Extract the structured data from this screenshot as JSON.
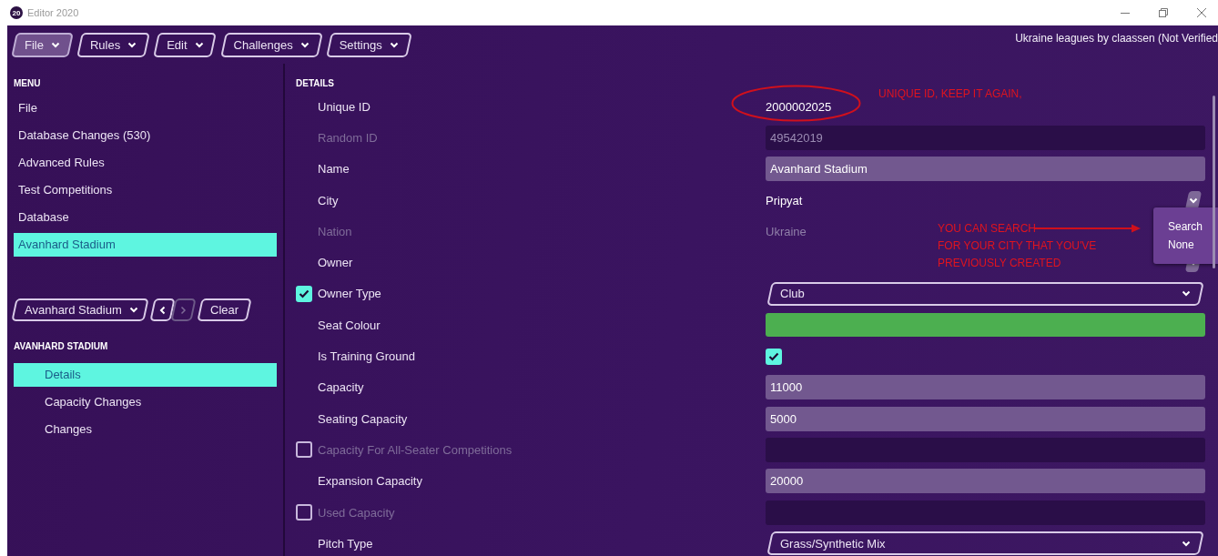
{
  "window": {
    "title": "Editor 2020",
    "logo": "20"
  },
  "menu_bar": [
    {
      "label": "File",
      "selected": true
    },
    {
      "label": "Rules",
      "selected": false
    },
    {
      "label": "Edit",
      "selected": false
    },
    {
      "label": "Challenges",
      "selected": false
    },
    {
      "label": "Settings",
      "selected": false
    }
  ],
  "project_label": "Ukraine leagues by claassen (Not Verified",
  "sidebar": {
    "heading": "MENU",
    "items": [
      {
        "label": "File",
        "selected": false
      },
      {
        "label": "Database Changes (530)",
        "selected": false
      },
      {
        "label": "Advanced Rules",
        "selected": false
      },
      {
        "label": "Test Competitions",
        "selected": false
      },
      {
        "label": "Database",
        "selected": false
      },
      {
        "label": "Avanhard Stadium",
        "selected": true
      }
    ],
    "picker": {
      "value": "Avanhard Stadium",
      "prev_disabled": false,
      "next_disabled": true,
      "clear_label": "Clear"
    },
    "section_heading": "AVANHARD STADIUM",
    "sub_items": [
      {
        "label": "Details",
        "selected": true
      },
      {
        "label": "Capacity Changes",
        "selected": false
      },
      {
        "label": "Changes",
        "selected": false
      }
    ]
  },
  "details": {
    "heading": "DETAILS",
    "rows": [
      {
        "label": "Unique ID",
        "kind": "text",
        "value": "2000002025",
        "disabled": false
      },
      {
        "label": "Random ID",
        "kind": "field",
        "value": "49542019",
        "disabled": true
      },
      {
        "label": "Name",
        "kind": "field",
        "value": "Avanhard Stadium",
        "disabled": false
      },
      {
        "label": "City",
        "kind": "picker",
        "value": "Pripyat",
        "disabled": false
      },
      {
        "label": "Nation",
        "kind": "text",
        "value": "Ukraine",
        "disabled": true
      },
      {
        "label": "Owner",
        "kind": "picker",
        "disabled": false
      },
      {
        "label": "Owner Type",
        "kind": "select",
        "value": "Club",
        "disabled": false,
        "checkbox": {
          "checked": true
        }
      },
      {
        "label": "Seat Colour",
        "kind": "swatch",
        "color": "#4caf50",
        "disabled": false
      },
      {
        "label": "Is Training Ground",
        "kind": "checkbox",
        "checked": true,
        "disabled": false
      },
      {
        "label": "Capacity",
        "kind": "field",
        "value": "11000",
        "disabled": false
      },
      {
        "label": "Seating Capacity",
        "kind": "field",
        "value": "5000",
        "disabled": false
      },
      {
        "label": "Capacity For All-Seater Competitions",
        "kind": "field",
        "disabled": true,
        "checkbox": {
          "checked": false
        }
      },
      {
        "label": "Expansion Capacity",
        "kind": "field",
        "value": "20000",
        "disabled": false
      },
      {
        "label": "Used Capacity",
        "kind": "field",
        "disabled": true,
        "checkbox": {
          "checked": false
        }
      },
      {
        "label": "Pitch Type",
        "kind": "select",
        "value": "Grass/Synthetic Mix",
        "disabled": false
      }
    ]
  },
  "city_menu": {
    "items": [
      "Search",
      "None"
    ]
  },
  "annotations": [
    {
      "kind": "id-note",
      "lines": [
        "UNIQUE ID, KEEP IT AGAIN,"
      ]
    },
    {
      "kind": "city-note",
      "lines": [
        "YOU CAN SEARCH",
        "FOR YOUR CITY THAT YOU'VE",
        "PREVIOUSLY CREATED"
      ]
    }
  ]
}
